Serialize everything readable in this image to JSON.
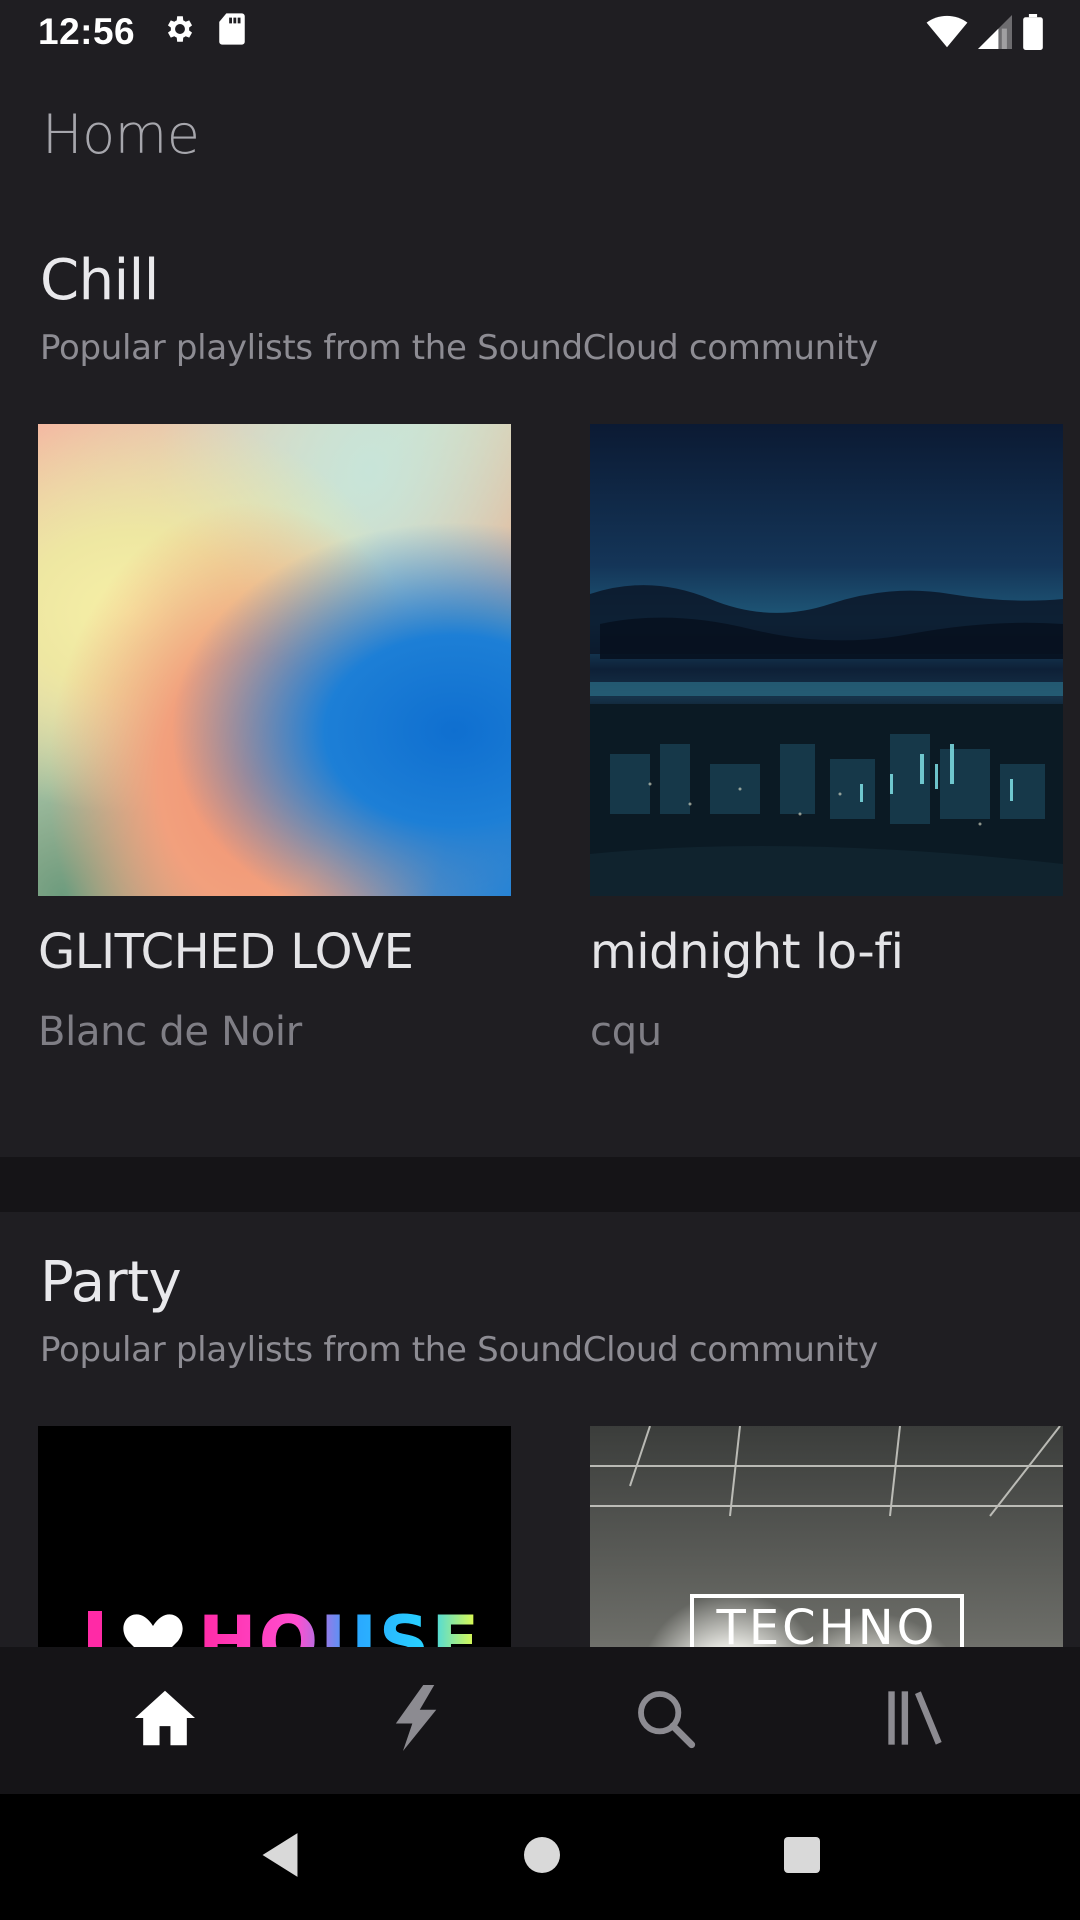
{
  "status_bar": {
    "time": "12:56",
    "left_icons": [
      "gear-icon",
      "sd-card-icon"
    ],
    "right_icons": [
      "wifi-icon",
      "cell-signal-icon",
      "battery-icon"
    ]
  },
  "page": {
    "title": "Home"
  },
  "sections": [
    {
      "title": "Chill",
      "subtitle": "Popular playlists from the SoundCloud community",
      "playlists": [
        {
          "title": "GLITCHED LOVE",
          "artist": "Blanc de Noir"
        },
        {
          "title": "midnight lo-fi",
          "artist": "cqu"
        }
      ]
    },
    {
      "title": "Party",
      "subtitle": "Popular playlists from the SoundCloud community",
      "playlists": [
        {
          "artwork_text": "I ♥ HOUSE"
        },
        {
          "artwork_text": "TECHNO"
        }
      ]
    }
  ],
  "bottom_nav": {
    "items": [
      "home-icon",
      "stream-lightning-icon",
      "search-icon",
      "library-icon"
    ],
    "active": "home-icon"
  },
  "system_nav": [
    "back-icon",
    "home-circle-icon",
    "recents-square-icon"
  ]
}
